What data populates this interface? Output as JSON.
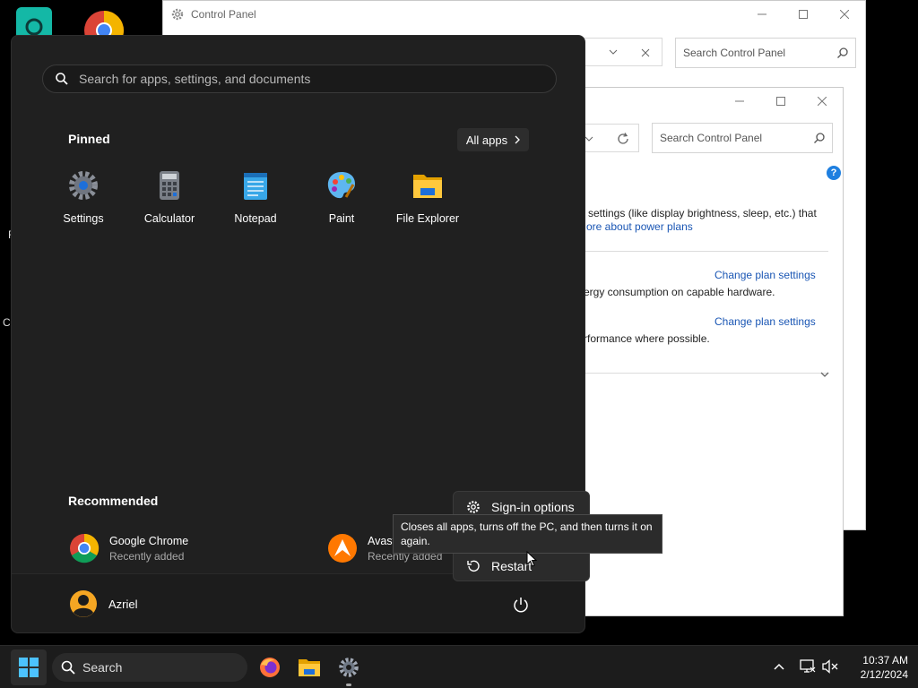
{
  "desktop": {
    "cut_label_1": "F",
    "cut_label_2": "Cl"
  },
  "control_panel_back": {
    "title": "Control Panel",
    "search_placeholder": "Search Control Panel"
  },
  "control_panel_front": {
    "search_placeholder": "Search Control Panel",
    "text_settings": "settings (like display brightness, sleep, etc.) that",
    "link_power_plans": "ore about power plans",
    "link_change_plan_1": "Change plan settings",
    "text_energy": "ergy consumption on capable hardware.",
    "link_change_plan_2": "Change plan settings",
    "text_performance": "rformance where possible."
  },
  "start_menu": {
    "search_placeholder": "Search for apps, settings, and documents",
    "pinned_heading": "Pinned",
    "all_apps_label": "All apps",
    "pinned": [
      {
        "label": "Settings"
      },
      {
        "label": "Calculator"
      },
      {
        "label": "Notepad"
      },
      {
        "label": "Paint"
      },
      {
        "label": "File Explorer"
      }
    ],
    "recommended_heading": "Recommended",
    "recommended": [
      {
        "title": "Google Chrome",
        "subtitle": "Recently added"
      },
      {
        "title": "Avast",
        "subtitle": "Recently added"
      }
    ],
    "user_name": "Azriel"
  },
  "power_flyout": {
    "items": [
      {
        "label": "Sign-in options"
      },
      {
        "label": "Restart"
      }
    ],
    "tooltip": "Closes all apps, turns off the PC, and then turns it on again."
  },
  "taskbar": {
    "search_label": "Search",
    "time": "10:37 AM",
    "date": "2/12/2024"
  },
  "colors": {
    "accent": "#0078d4",
    "start_bg": "#202020",
    "link": "#1a56b4"
  }
}
